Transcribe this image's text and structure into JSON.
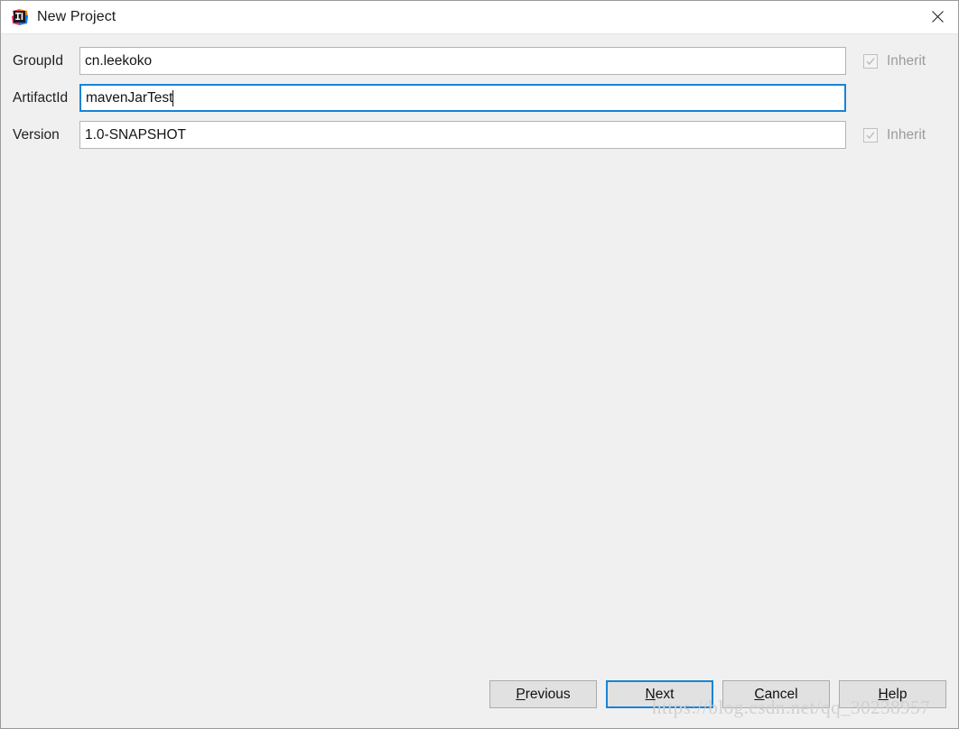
{
  "window": {
    "title": "New Project",
    "icon": "intellij-idea-logo",
    "close_icon": "close-icon"
  },
  "form": {
    "rows": [
      {
        "label": "GroupId",
        "value": "cn.leekoko",
        "focused": false,
        "has_caret": false,
        "inherit": {
          "visible": true,
          "label": "Inherit",
          "checked": true,
          "enabled": false
        }
      },
      {
        "label": "ArtifactId",
        "value": "mavenJarTest",
        "focused": true,
        "has_caret": true,
        "inherit": {
          "visible": false,
          "label": "",
          "checked": false,
          "enabled": false
        }
      },
      {
        "label": "Version",
        "value": "1.0-SNAPSHOT",
        "focused": false,
        "has_caret": false,
        "inherit": {
          "visible": true,
          "label": "Inherit",
          "checked": true,
          "enabled": false
        }
      }
    ]
  },
  "footer": {
    "buttons": [
      {
        "label": "Previous",
        "mnemonic": "P",
        "default": false
      },
      {
        "label": "Next",
        "mnemonic": "N",
        "default": true
      },
      {
        "label": "Cancel",
        "mnemonic": "C",
        "default": false
      },
      {
        "label": "Help",
        "mnemonic": "H",
        "default": false
      }
    ]
  },
  "watermark": {
    "text": "https://blog.csdn.net/qq_30238957"
  },
  "colors": {
    "accent": "#1884d6",
    "dialog_background": "#f0f0f0",
    "titlebar_background": "#ffffff",
    "button_background": "#e1e1e1",
    "disabled_text": "#9b9b9b"
  }
}
